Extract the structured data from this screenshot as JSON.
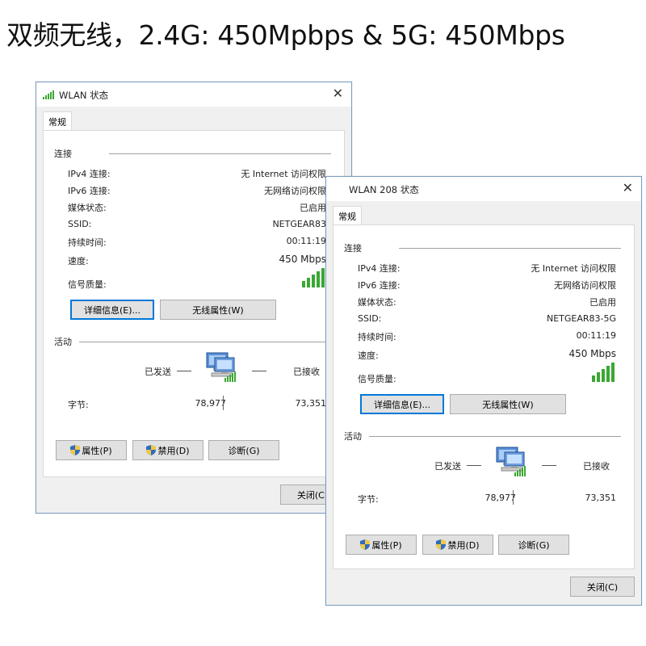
{
  "headline": "双频无线，2.4G: 450Mpbps & 5G: 450Mbps",
  "windows": [
    {
      "title": "WLAN 状态",
      "tab": "常规",
      "connection_label": "连接",
      "rows": [
        {
          "label": "IPv4 连接:",
          "value": "无 Internet 访问权限"
        },
        {
          "label": "IPv6 连接:",
          "value": "无网络访问权限"
        },
        {
          "label": "媒体状态:",
          "value": "已启用"
        },
        {
          "label": "SSID:",
          "value": "NETGEAR83"
        },
        {
          "label": "持续时间:",
          "value": "00:11:19"
        },
        {
          "label": "速度:",
          "value": "450 Mbps"
        }
      ],
      "signal_label": "信号质量:",
      "signal_bars": 5,
      "details_button": "详细信息(E)...",
      "wireless_props_button": "无线属性(W)",
      "activity_label": "活动",
      "sent_label": "已发送",
      "received_label": "已接收",
      "bytes_label": "字节:",
      "bytes_sent": "78,977",
      "bytes_received": "73,351",
      "properties_button": "属性(P)",
      "disable_button": "禁用(D)",
      "diagnose_button": "诊断(G)",
      "close_button": "关闭(C)"
    },
    {
      "title": "WLAN 208 状态",
      "tab": "常规",
      "connection_label": "连接",
      "rows": [
        {
          "label": "IPv4 连接:",
          "value": "无 Internet 访问权限"
        },
        {
          "label": "IPv6 连接:",
          "value": "无网络访问权限"
        },
        {
          "label": "媒体状态:",
          "value": "已启用"
        },
        {
          "label": "SSID:",
          "value": "NETGEAR83-5G"
        },
        {
          "label": "持续时间:",
          "value": "00:11:19"
        },
        {
          "label": "速度:",
          "value": "450 Mbps"
        }
      ],
      "signal_label": "信号质量:",
      "signal_bars": 5,
      "details_button": "详细信息(E)...",
      "wireless_props_button": "无线属性(W)",
      "activity_label": "活动",
      "sent_label": "已发送",
      "received_label": "已接收",
      "bytes_label": "字节:",
      "bytes_sent": "78,977",
      "bytes_received": "73,351",
      "properties_button": "属性(P)",
      "disable_button": "禁用(D)",
      "diagnose_button": "诊断(G)",
      "close_button": "关闭(C)"
    }
  ],
  "colors": {
    "accent": "#0078d7",
    "signal": "#3aa832",
    "border": "#7a9cc4"
  }
}
